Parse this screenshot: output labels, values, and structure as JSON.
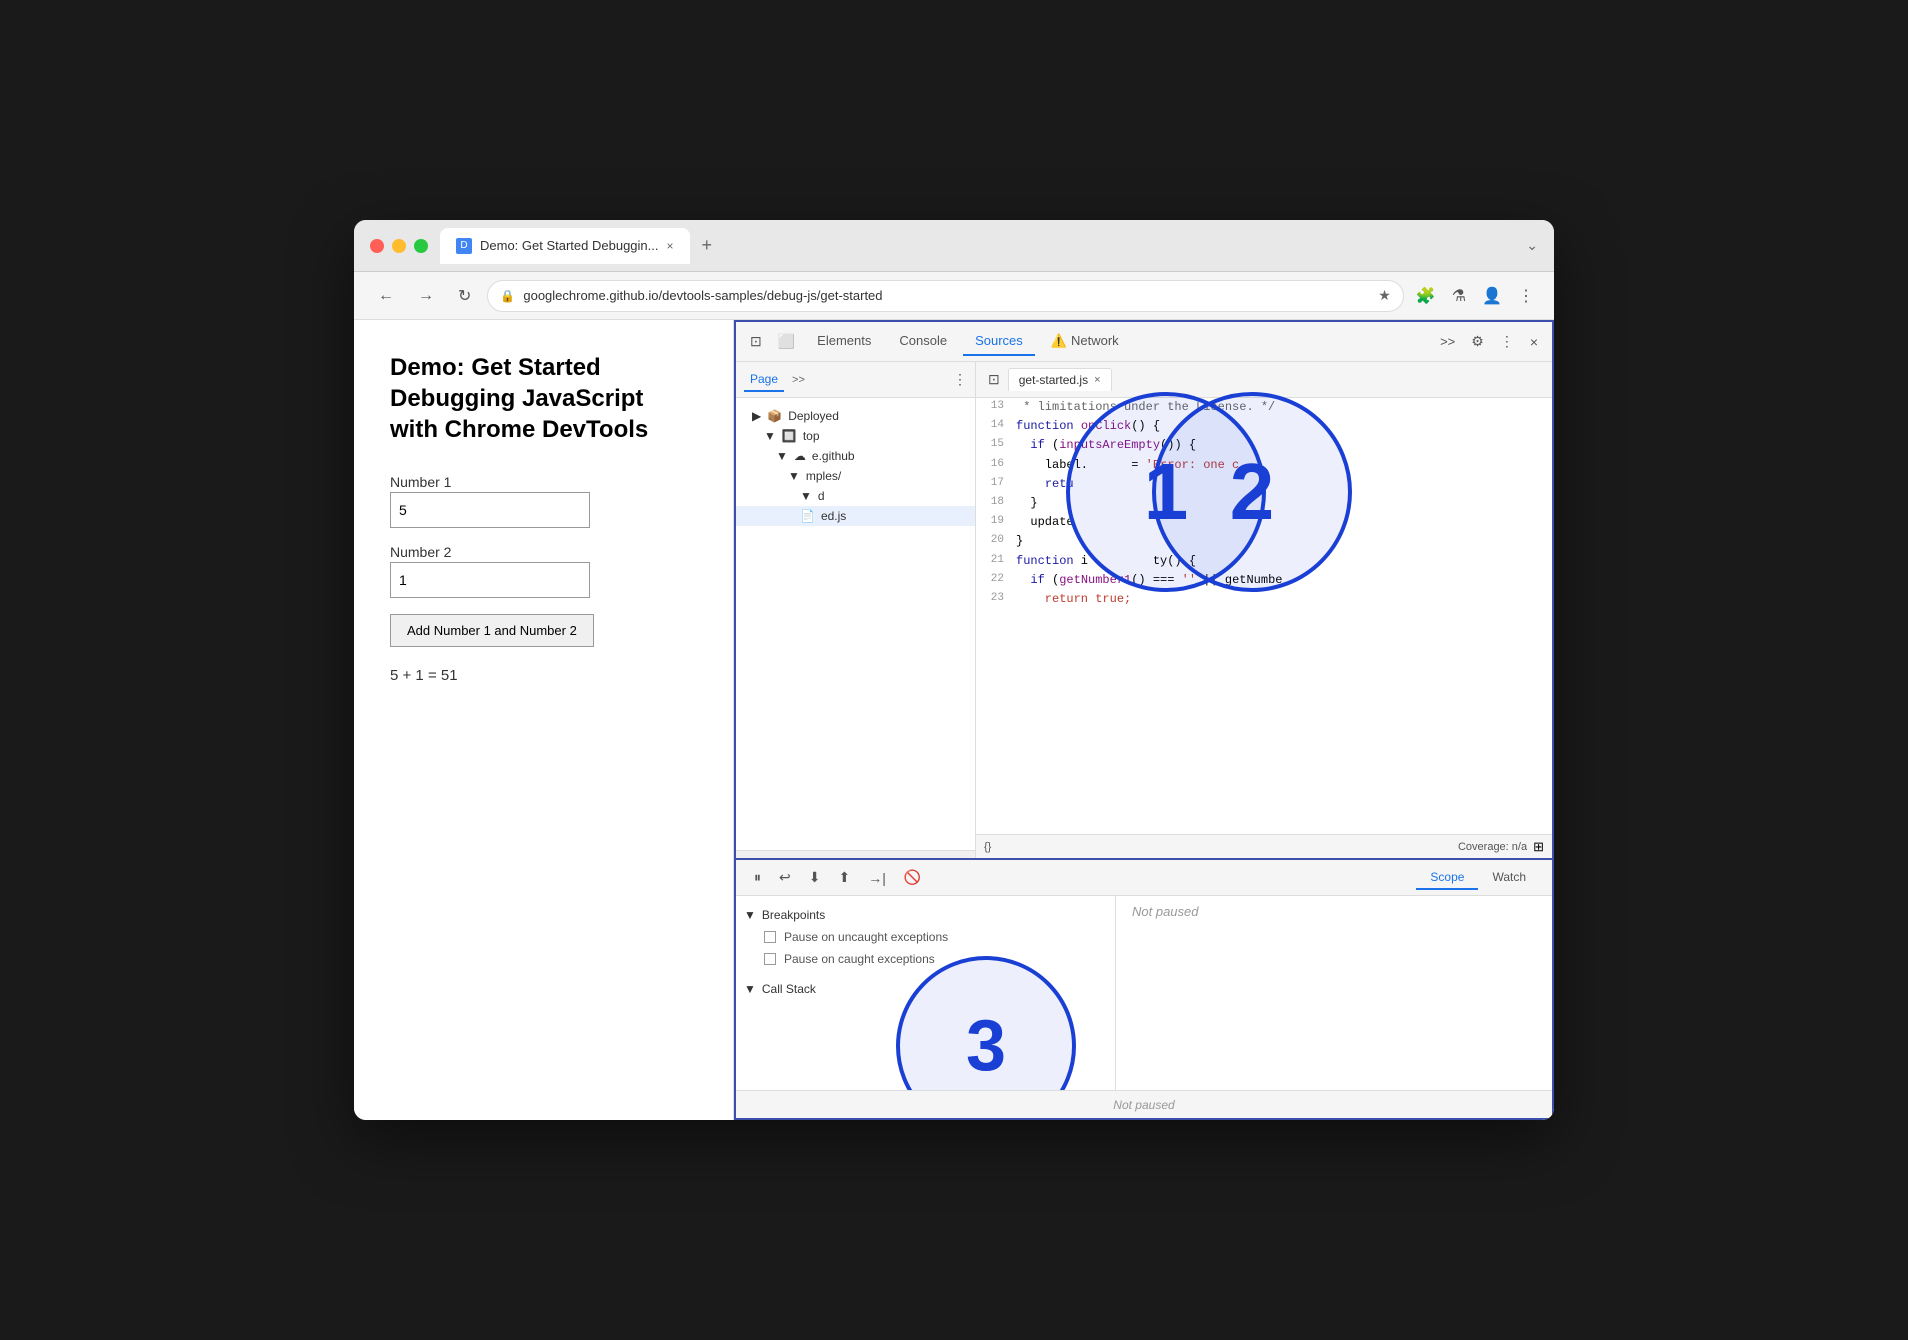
{
  "browser": {
    "tab_title": "Demo: Get Started Debuggin...",
    "tab_close": "×",
    "new_tab": "+",
    "url": "googlechrome.github.io/devtools-samples/debug-js/get-started",
    "dropdown": "⌄"
  },
  "nav": {
    "back": "←",
    "forward": "→",
    "refresh": "↻",
    "star": "★",
    "extensions": "🧩",
    "flask": "⚗",
    "profile": "👤",
    "more": "⋮"
  },
  "page": {
    "title": "Demo: Get Started Debugging JavaScript with Chrome DevTools",
    "label1": "Number 1",
    "input1_value": "5",
    "label2": "Number 2",
    "input2_value": "1",
    "button_label": "Add Number 1 and Number 2",
    "result": "5 + 1 = 51"
  },
  "devtools": {
    "tabs": [
      "Elements",
      "Console",
      "Sources",
      "Network"
    ],
    "active_tab": "Sources",
    "warning_tab": "Network",
    "more": ">>",
    "gear": "⚙",
    "dots": "⋮",
    "close": "×",
    "inspect_icon": "⊡",
    "device_icon": "⬜"
  },
  "sources_panel": {
    "left_tab": "Page",
    "more": ">>",
    "file_tree": [
      {
        "label": "Deployed",
        "indent": 0,
        "icon": "📦",
        "arrow": "▶"
      },
      {
        "label": "top",
        "indent": 1,
        "icon": "",
        "arrow": "▼"
      },
      {
        "label": "e.github",
        "indent": 2,
        "icon": "☁",
        "arrow": "▼"
      },
      {
        "label": "mples/",
        "indent": 3,
        "icon": "",
        "arrow": "▼"
      },
      {
        "label": "d",
        "indent": 4,
        "icon": "",
        "arrow": "▼"
      },
      {
        "label": "ed.js",
        "indent": 4,
        "icon": "📄",
        "arrow": "",
        "selected": true
      }
    ],
    "editor_tab": "get-started.js",
    "code_lines": [
      {
        "num": 13,
        "content": " * limitations under the License. */"
      },
      {
        "num": 14,
        "content": "function onClick() {"
      },
      {
        "num": 15,
        "content": "  if (inputsAreEmpty()) {"
      },
      {
        "num": 16,
        "content": "    label.      = 'Error: one c"
      },
      {
        "num": 17,
        "content": "    retu"
      },
      {
        "num": 18,
        "content": "  }"
      },
      {
        "num": 19,
        "content": "  update"
      },
      {
        "num": 20,
        "content": "}"
      },
      {
        "num": 21,
        "content": "function i         ty() {"
      },
      {
        "num": 22,
        "content": "  if (getNumber1() === '' || getNumbe"
      },
      {
        "num": 23,
        "content": "    return true;"
      }
    ],
    "status_bar": "{}",
    "coverage": "Coverage: n/a"
  },
  "debugger": {
    "toolbar_buttons": [
      "⏸",
      "↩",
      "⬇",
      "⬆",
      "→|",
      "🚫"
    ],
    "tabs": [
      "Scope",
      "Watch"
    ],
    "active_tab": "Scope",
    "not_paused": "Not paused",
    "breakpoints_header": "Breakpoints",
    "bp_items": [
      "Pause on uncaught exceptions",
      "Pause on caught exceptions"
    ],
    "call_stack_header": "Call Stack",
    "not_paused_bar": "Not paused"
  },
  "circles": [
    {
      "id": 1,
      "label": "1"
    },
    {
      "id": 2,
      "label": "2"
    },
    {
      "id": 3,
      "label": "3"
    }
  ]
}
